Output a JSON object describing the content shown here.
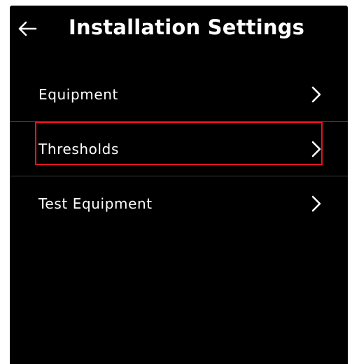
{
  "header": {
    "back_icon": "arrow-left-icon",
    "title": "Installation Settings"
  },
  "menu": {
    "items": [
      {
        "label": "Equipment",
        "icon": "chevron-right-icon"
      },
      {
        "label": "Thresholds",
        "icon": "chevron-right-icon",
        "highlighted": true
      },
      {
        "label": "Test Equipment",
        "icon": "chevron-right-icon"
      }
    ]
  },
  "colors": {
    "background": "#000000",
    "text": "#ffffff",
    "divider": "#3a3a3a",
    "highlight": "#e0161e"
  }
}
